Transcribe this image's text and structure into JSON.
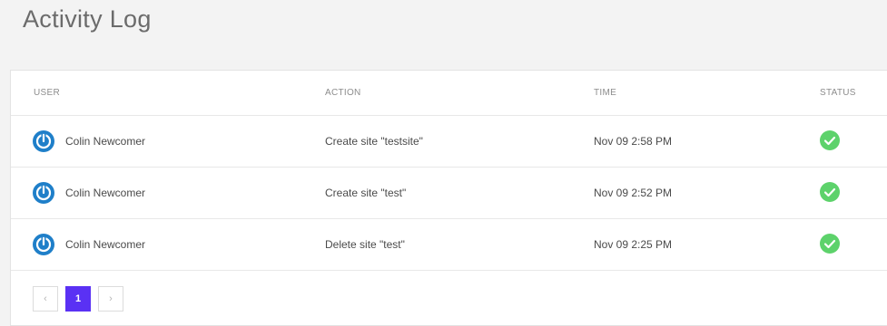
{
  "page": {
    "title": "Activity Log"
  },
  "table": {
    "columns": {
      "user": "USER",
      "action": "ACTION",
      "time": "TIME",
      "status": "STATUS"
    },
    "rows": [
      {
        "user": "Colin Newcomer",
        "action": "Create site \"testsite\"",
        "time": "Nov 09 2:58 PM",
        "status": "success-check-icon"
      },
      {
        "user": "Colin Newcomer",
        "action": "Create site \"test\"",
        "time": "Nov 09 2:52 PM",
        "status": "success-check-icon"
      },
      {
        "user": "Colin Newcomer",
        "action": "Delete site \"test\"",
        "time": "Nov 09 2:25 PM",
        "status": "success-check-icon"
      }
    ]
  },
  "pagination": {
    "prev": "‹",
    "current": "1",
    "next": "›"
  },
  "colors": {
    "accent": "#5a31f4",
    "avatar": "#1f7fc9",
    "success": "#5dd26b"
  }
}
